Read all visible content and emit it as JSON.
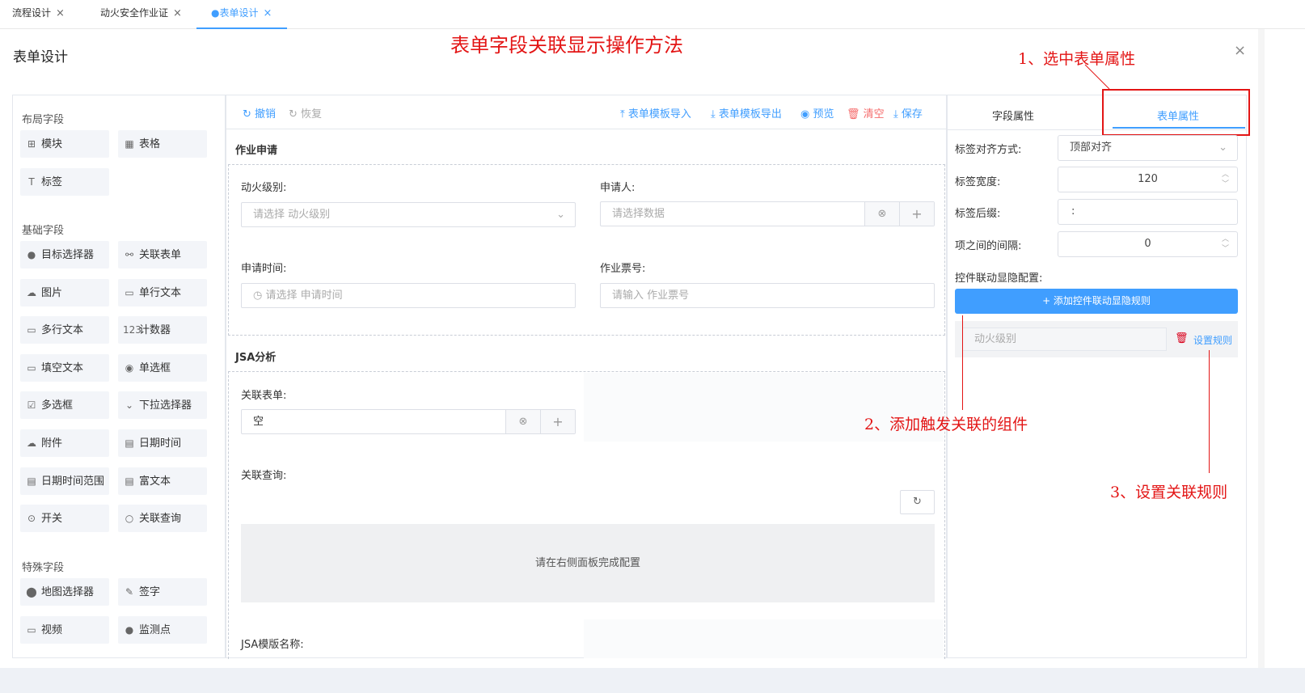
{
  "tabs": [
    {
      "label": "流程设计",
      "close": "×"
    },
    {
      "label": "动火安全作业证",
      "close": "×"
    },
    {
      "label": "●表单设计",
      "close": "×"
    }
  ],
  "page_title": "表单设计",
  "close_icon": "×",
  "annotations": {
    "title": "表单字段关联显示操作方法",
    "step1": "1、选中表单属性",
    "step2": "2、添加触发关联的组件",
    "step3": "3、设置关联规则"
  },
  "palette": {
    "layout_title": "布局字段",
    "layout": [
      {
        "icon": "grid-icon",
        "glyph": "⊞",
        "label": "模块"
      },
      {
        "icon": "table-icon",
        "glyph": "▦",
        "label": "表格"
      },
      {
        "icon": "text-t-icon",
        "glyph": "T",
        "label": "标签"
      }
    ],
    "basic_title": "基础字段",
    "basic": [
      {
        "icon": "user-icon",
        "glyph": "●",
        "label": "目标选择器"
      },
      {
        "icon": "link-icon",
        "glyph": "⚯",
        "label": "关联表单"
      },
      {
        "icon": "cloud-icon",
        "glyph": "☁",
        "label": "图片"
      },
      {
        "icon": "input-icon",
        "glyph": "▭",
        "label": "单行文本"
      },
      {
        "icon": "textarea-icon",
        "glyph": "▭",
        "label": "多行文本"
      },
      {
        "icon": "number-icon",
        "glyph": "123",
        "label": "计数器"
      },
      {
        "icon": "fill-icon",
        "glyph": "▭",
        "label": "填空文本"
      },
      {
        "icon": "radio-icon",
        "glyph": "◉",
        "label": "单选框"
      },
      {
        "icon": "checkbox-icon",
        "glyph": "☑",
        "label": "多选框"
      },
      {
        "icon": "dropdown-icon",
        "glyph": "⌄",
        "label": "下拉选择器"
      },
      {
        "icon": "attachment-icon",
        "glyph": "☁",
        "label": "附件"
      },
      {
        "icon": "calendar-icon",
        "glyph": "▤",
        "label": "日期时间"
      },
      {
        "icon": "date-range-icon",
        "glyph": "▤",
        "label": "日期时间范围"
      },
      {
        "icon": "richtext-icon",
        "glyph": "▤",
        "label": "富文本"
      },
      {
        "icon": "switch-icon",
        "glyph": "⊙",
        "label": "开关"
      },
      {
        "icon": "search-icon",
        "glyph": "○",
        "label": "关联查询"
      }
    ],
    "special_title": "特殊字段",
    "special": [
      {
        "icon": "map-pin-icon",
        "glyph": "⬤",
        "label": "地图选择器"
      },
      {
        "icon": "signature-icon",
        "glyph": "✎",
        "label": "签字"
      },
      {
        "icon": "video-icon",
        "glyph": "▭",
        "label": "视频"
      },
      {
        "icon": "monitor-point-icon",
        "glyph": "●",
        "label": "监测点"
      }
    ]
  },
  "toolbar": {
    "undo": "撤销",
    "redo": "恢复",
    "import": "表单模板导入",
    "export": "表单模板导出",
    "preview": "预览",
    "clear": "清空",
    "save": "保存"
  },
  "canvas": {
    "group1": "作业申请",
    "fire_level_label": "动火级别:",
    "fire_level_placeholder": "请选择 动火级别",
    "applicant_label": "申请人:",
    "applicant_placeholder": "请选择数据",
    "apply_time_label": "申请时间:",
    "apply_time_placeholder": "请选择 申请时间",
    "ticket_label": "作业票号:",
    "ticket_placeholder": "请输入 作业票号",
    "group2": "JSA分析",
    "related_form_label": "关联表单:",
    "related_form_value": "空",
    "related_query_label": "关联查询:",
    "query_placeholder": "请在右侧面板完成配置",
    "jsa_template_label": "JSA模版名称:"
  },
  "right_panel": {
    "tab_field": "字段属性",
    "tab_form": "表单属性",
    "label_align_label": "标签对齐方式:",
    "label_align_value": "顶部对齐",
    "label_width_label": "标签宽度:",
    "label_width_value": "120",
    "label_suffix_label": "标签后缀:",
    "label_suffix_value": ":",
    "item_gap_label": "项之间的间隔:",
    "item_gap_value": "0",
    "linkage_label": "控件联动显隐配置:",
    "add_rule_button": "+ 添加控件联动显隐规则",
    "rule_field": "动火级别",
    "set_rule": "设置规则"
  },
  "colors": {
    "accent": "#409eff",
    "danger": "#f56c6c",
    "annotation": "#e31515"
  }
}
